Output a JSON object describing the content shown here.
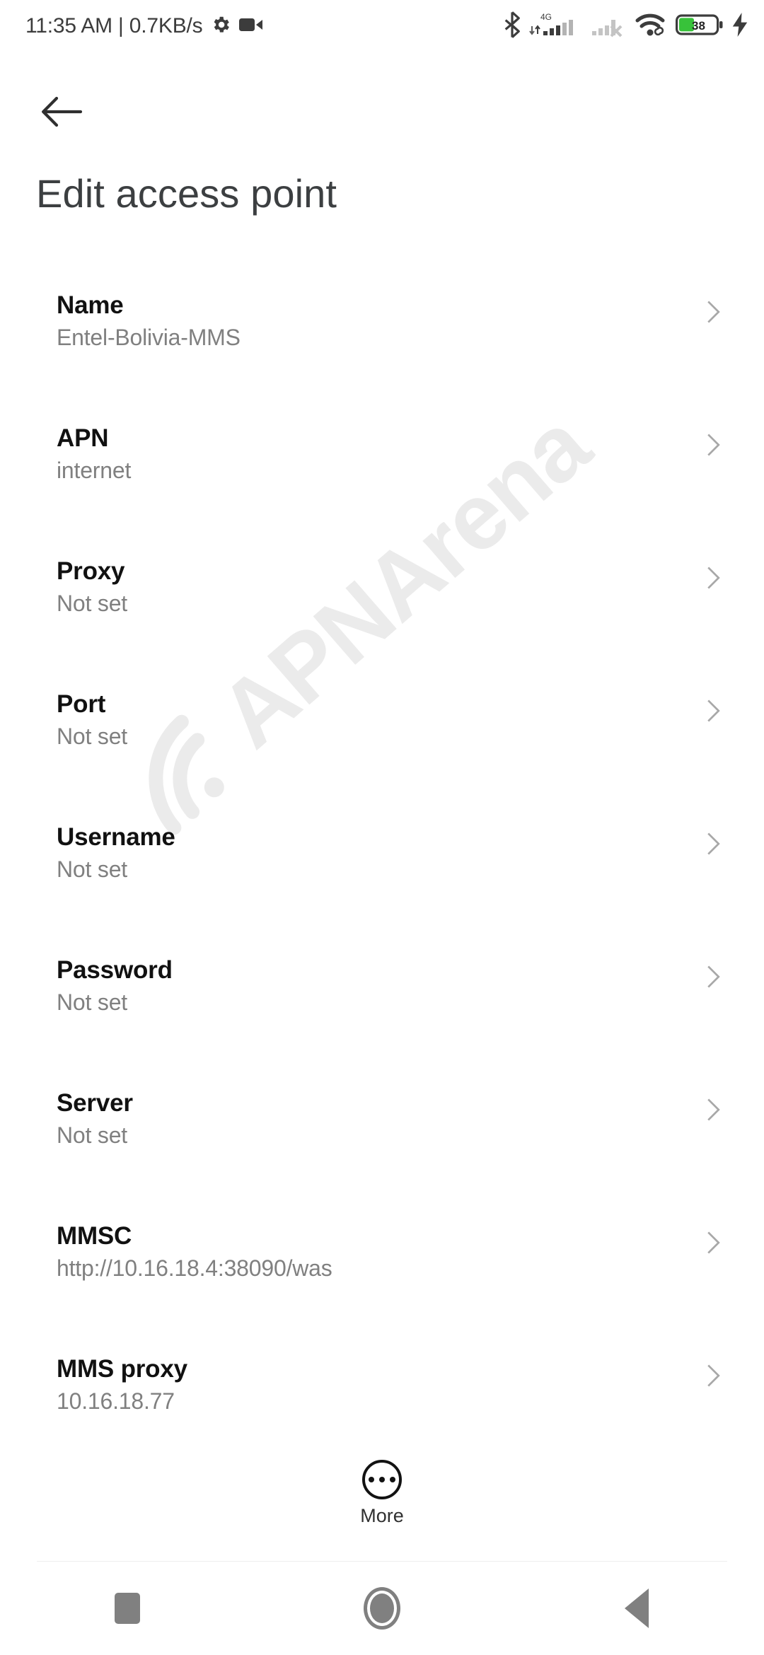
{
  "status_bar": {
    "clock_text": "11:35 AM | 0.7KB/s",
    "network_label": "4G",
    "battery_level": "38",
    "battery_color": "#38c23a",
    "icons": [
      "settings-gear-icon",
      "video-recorder-icon",
      "bluetooth-icon",
      "mobile-signal-4g-icon",
      "sim2-no-service-icon",
      "wifi-icon",
      "battery-icon",
      "charging-bolt-icon"
    ]
  },
  "app_bar": {
    "back_label": "Back",
    "title": "Edit access point"
  },
  "watermark": {
    "text": "APNArena",
    "color": "#ebebeb"
  },
  "settings": {
    "rows": [
      {
        "title": "Name",
        "value": "Entel-Bolivia-MMS"
      },
      {
        "title": "APN",
        "value": "internet"
      },
      {
        "title": "Proxy",
        "value": "Not set"
      },
      {
        "title": "Port",
        "value": "Not set"
      },
      {
        "title": "Username",
        "value": "Not set"
      },
      {
        "title": "Password",
        "value": "Not set"
      },
      {
        "title": "Server",
        "value": "Not set"
      },
      {
        "title": "MMSC",
        "value": "http://10.16.18.4:38090/was"
      },
      {
        "title": "MMS proxy",
        "value": "10.16.18.77"
      }
    ]
  },
  "more_button": {
    "label": "More"
  },
  "nav_bar": {
    "recents_label": "Recents",
    "home_label": "Home",
    "back_label": "Back"
  }
}
